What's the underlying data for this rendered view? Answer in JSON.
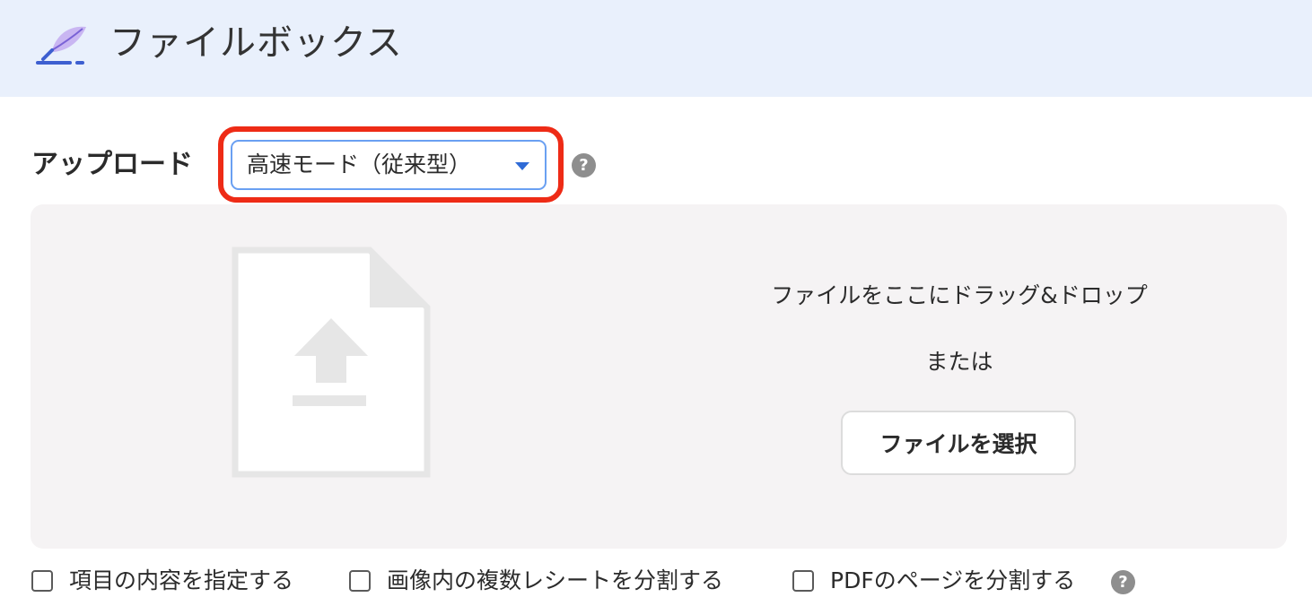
{
  "header": {
    "title": "ファイルボックス",
    "logo_icon": "feather-pen-icon",
    "background": "#e9f0fc"
  },
  "upload": {
    "label": "アップロード",
    "mode_select": {
      "value": "高速モード（従来型）",
      "highlight_color": "#ee2b16",
      "border_color": "#6aa0f2"
    },
    "help_icon": "question-circle-icon"
  },
  "dropzone": {
    "icon": "file-upload-icon",
    "instruction": "ファイルをここにドラッグ&ドロップ",
    "or_text": "または",
    "select_button": "ファイルを選択"
  },
  "options": [
    {
      "label": "項目の内容を指定する",
      "checked": false
    },
    {
      "label": "画像内の複数レシートを分割する",
      "checked": false
    },
    {
      "label": "PDFのページを分割する",
      "checked": false
    }
  ],
  "options_help_icon": "question-circle-icon",
  "help_glyph": "?"
}
